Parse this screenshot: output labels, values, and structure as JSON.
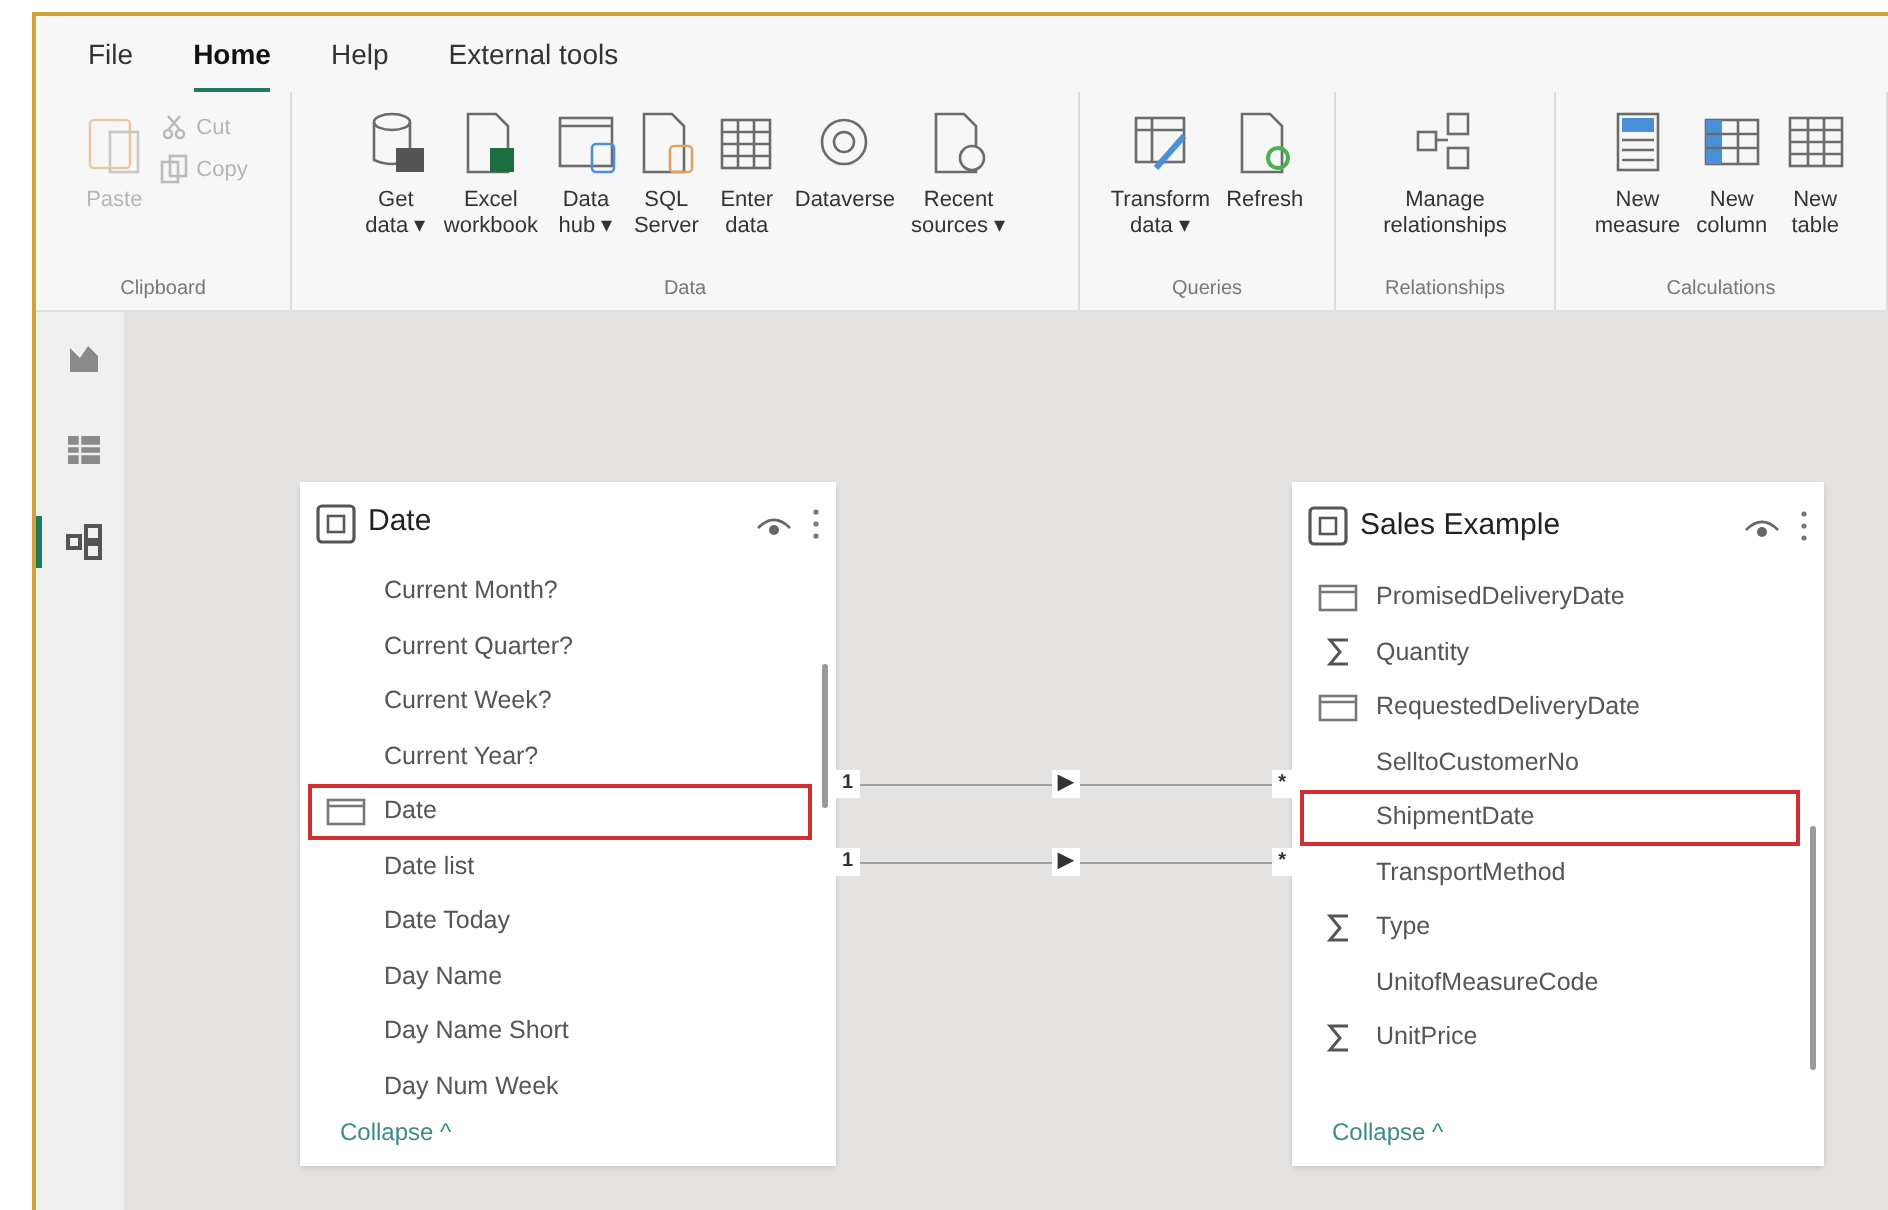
{
  "menu_tabs": [
    {
      "label": "File",
      "selected": false
    },
    {
      "label": "Home",
      "selected": true
    },
    {
      "label": "Help",
      "selected": false
    },
    {
      "label": "External tools",
      "selected": false
    }
  ],
  "ribbon_groups": [
    {
      "label": "Clipboard",
      "buttons": [
        {
          "kind": "large",
          "lines": [
            "Paste"
          ],
          "disabled": true
        },
        {
          "kind": "small",
          "lines": [
            "Cut"
          ],
          "disabled": true
        },
        {
          "kind": "small",
          "lines": [
            "Copy"
          ],
          "disabled": true
        }
      ]
    },
    {
      "label": "Data",
      "buttons": [
        {
          "kind": "large",
          "lines": [
            "Get",
            "data ▾"
          ],
          "disabled": false
        },
        {
          "kind": "large",
          "lines": [
            "Excel",
            "workbook"
          ],
          "disabled": false
        },
        {
          "kind": "large",
          "lines": [
            "Data",
            "hub ▾"
          ],
          "disabled": false
        },
        {
          "kind": "large",
          "lines": [
            "SQL",
            "Server"
          ],
          "disabled": false
        },
        {
          "kind": "large",
          "lines": [
            "Enter",
            "data"
          ],
          "disabled": false
        },
        {
          "kind": "large",
          "lines": [
            "Dataverse"
          ],
          "disabled": false
        },
        {
          "kind": "large",
          "lines": [
            "Recent",
            "sources ▾"
          ],
          "disabled": false
        }
      ]
    },
    {
      "label": "Queries",
      "buttons": [
        {
          "kind": "large",
          "lines": [
            "Transform",
            "data ▾"
          ],
          "disabled": false
        },
        {
          "kind": "large",
          "lines": [
            "Refresh"
          ],
          "disabled": false
        }
      ]
    },
    {
      "label": "Relationships",
      "buttons": [
        {
          "kind": "large",
          "lines": [
            "Manage",
            "relationships"
          ],
          "disabled": false
        }
      ]
    },
    {
      "label": "Calculations",
      "buttons": [
        {
          "kind": "large",
          "lines": [
            "New",
            "measure"
          ],
          "disabled": false
        },
        {
          "kind": "large",
          "lines": [
            "New",
            "column"
          ],
          "disabled": false
        },
        {
          "kind": "large",
          "lines": [
            "New",
            "table"
          ],
          "disabled": false
        }
      ]
    }
  ],
  "view_rail": [
    {
      "selected": false
    },
    {
      "selected": false
    },
    {
      "selected": true
    }
  ],
  "tables": [
    {
      "title": "Date",
      "fields": [
        {
          "name": "Current Month?",
          "kind": "plain",
          "highlighted": false
        },
        {
          "name": "Current Quarter?",
          "kind": "plain",
          "highlighted": false
        },
        {
          "name": "Current Week?",
          "kind": "plain",
          "highlighted": false
        },
        {
          "name": "Current Year?",
          "kind": "plain",
          "highlighted": false
        },
        {
          "name": "Date",
          "kind": "date",
          "highlighted": true
        },
        {
          "name": "Date list",
          "kind": "plain",
          "highlighted": false
        },
        {
          "name": "Date Today",
          "kind": "plain",
          "highlighted": false
        },
        {
          "name": "Day Name",
          "kind": "plain",
          "highlighted": false
        },
        {
          "name": "Day Name Short",
          "kind": "plain",
          "highlighted": false
        },
        {
          "name": "Day Num Week",
          "kind": "plain",
          "highlighted": false
        }
      ],
      "footer": "Collapse ^"
    },
    {
      "title": "Sales Example",
      "fields": [
        {
          "name": "PromisedDeliveryDate",
          "kind": "date",
          "highlighted": false
        },
        {
          "name": "Quantity",
          "kind": "sum",
          "highlighted": false
        },
        {
          "name": "RequestedDeliveryDate",
          "kind": "date",
          "highlighted": false
        },
        {
          "name": "SelltoCustomerNo",
          "kind": "plain",
          "highlighted": false
        },
        {
          "name": "ShipmentDate",
          "kind": "plain",
          "highlighted": true
        },
        {
          "name": "TransportMethod",
          "kind": "plain",
          "highlighted": false
        },
        {
          "name": "Type",
          "kind": "sum",
          "highlighted": false
        },
        {
          "name": "UnitofMeasureCode",
          "kind": "plain",
          "highlighted": false
        },
        {
          "name": "UnitPrice",
          "kind": "sum",
          "highlighted": false
        }
      ],
      "footer": "Collapse ^"
    }
  ],
  "relationships": [
    {
      "from": "1",
      "direction": "▶",
      "to": "*"
    },
    {
      "from": "1",
      "direction": "▶",
      "to": "*"
    }
  ]
}
